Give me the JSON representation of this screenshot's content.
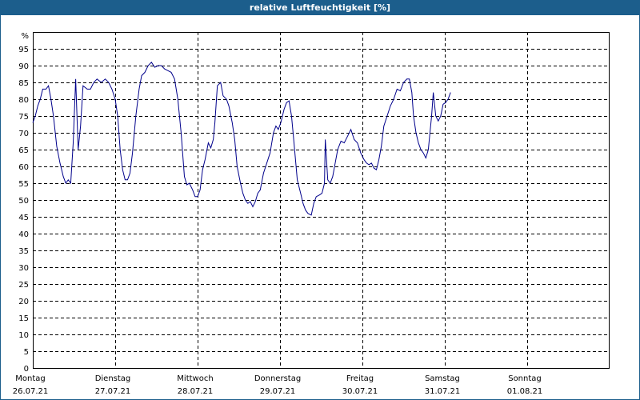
{
  "chart_data": {
    "type": "line",
    "title": "relative Luftfeuchtigkeit [%]",
    "yunit": "%",
    "ylim": [
      0,
      100
    ],
    "yticks": [
      0,
      5,
      10,
      15,
      20,
      25,
      30,
      35,
      40,
      45,
      50,
      55,
      60,
      65,
      70,
      75,
      80,
      85,
      90,
      95
    ],
    "xlim": [
      0,
      7
    ],
    "grid": true,
    "days": [
      {
        "name": "Montag",
        "date": "26.07.21"
      },
      {
        "name": "Dienstag",
        "date": "27.07.21"
      },
      {
        "name": "Mittwoch",
        "date": "28.07.21"
      },
      {
        "name": "Donnerstag",
        "date": "29.07.21"
      },
      {
        "name": "Freitag",
        "date": "30.07.21"
      },
      {
        "name": "Samstag",
        "date": "31.07.21"
      },
      {
        "name": "Sonntag",
        "date": "01.08.21"
      }
    ],
    "series": [
      {
        "color": "#00008b",
        "points": [
          [
            0.0,
            73
          ],
          [
            0.03,
            75
          ],
          [
            0.06,
            78
          ],
          [
            0.09,
            80
          ],
          [
            0.12,
            83
          ],
          [
            0.16,
            83
          ],
          [
            0.19,
            84
          ],
          [
            0.22,
            80
          ],
          [
            0.25,
            75
          ],
          [
            0.29,
            66
          ],
          [
            0.33,
            61
          ],
          [
            0.37,
            57
          ],
          [
            0.4,
            55
          ],
          [
            0.43,
            56
          ],
          [
            0.46,
            55
          ],
          [
            0.49,
            67
          ],
          [
            0.52,
            86
          ],
          [
            0.55,
            65
          ],
          [
            0.58,
            72
          ],
          [
            0.61,
            84
          ],
          [
            0.66,
            83
          ],
          [
            0.7,
            83
          ],
          [
            0.74,
            85
          ],
          [
            0.78,
            86
          ],
          [
            0.83,
            85
          ],
          [
            0.88,
            86
          ],
          [
            0.92,
            85
          ],
          [
            0.96,
            83
          ],
          [
            1.0,
            80
          ],
          [
            1.03,
            75
          ],
          [
            1.06,
            65
          ],
          [
            1.09,
            59
          ],
          [
            1.12,
            56
          ],
          [
            1.15,
            56
          ],
          [
            1.18,
            58
          ],
          [
            1.21,
            64
          ],
          [
            1.25,
            75
          ],
          [
            1.29,
            83
          ],
          [
            1.32,
            87
          ],
          [
            1.36,
            88
          ],
          [
            1.4,
            90
          ],
          [
            1.44,
            91
          ],
          [
            1.48,
            89.5
          ],
          [
            1.52,
            90
          ],
          [
            1.56,
            90
          ],
          [
            1.6,
            89
          ],
          [
            1.64,
            88.5
          ],
          [
            1.68,
            88
          ],
          [
            1.72,
            86
          ],
          [
            1.76,
            80
          ],
          [
            1.8,
            70
          ],
          [
            1.84,
            57
          ],
          [
            1.87,
            54.5
          ],
          [
            1.9,
            55
          ],
          [
            1.94,
            53
          ],
          [
            1.97,
            51
          ],
          [
            2.0,
            51
          ],
          [
            2.03,
            53
          ],
          [
            2.06,
            59
          ],
          [
            2.09,
            62
          ],
          [
            2.13,
            67
          ],
          [
            2.16,
            65.5
          ],
          [
            2.19,
            68
          ],
          [
            2.21,
            73
          ],
          [
            2.24,
            84
          ],
          [
            2.28,
            85
          ],
          [
            2.31,
            81
          ],
          [
            2.35,
            80
          ],
          [
            2.38,
            78
          ],
          [
            2.42,
            73
          ],
          [
            2.45,
            68
          ],
          [
            2.48,
            60
          ],
          [
            2.52,
            55
          ],
          [
            2.55,
            52
          ],
          [
            2.58,
            50
          ],
          [
            2.61,
            49
          ],
          [
            2.64,
            49.5
          ],
          [
            2.67,
            48
          ],
          [
            2.7,
            49.5
          ],
          [
            2.73,
            52
          ],
          [
            2.76,
            53
          ],
          [
            2.8,
            58
          ],
          [
            2.84,
            61
          ],
          [
            2.88,
            64
          ],
          [
            2.92,
            70
          ],
          [
            2.95,
            72
          ],
          [
            2.98,
            71
          ],
          [
            3.01,
            73
          ],
          [
            3.05,
            77
          ],
          [
            3.08,
            79
          ],
          [
            3.11,
            79.5
          ],
          [
            3.14,
            75
          ],
          [
            3.17,
            67
          ],
          [
            3.21,
            56
          ],
          [
            3.25,
            52
          ],
          [
            3.28,
            49
          ],
          [
            3.31,
            47
          ],
          [
            3.34,
            46
          ],
          [
            3.38,
            45.5
          ],
          [
            3.41,
            49
          ],
          [
            3.44,
            51
          ],
          [
            3.48,
            51.5
          ],
          [
            3.51,
            52
          ],
          [
            3.54,
            55
          ],
          [
            3.55,
            68
          ],
          [
            3.58,
            56
          ],
          [
            3.61,
            55
          ],
          [
            3.64,
            57
          ],
          [
            3.67,
            61
          ],
          [
            3.7,
            65
          ],
          [
            3.74,
            67.5
          ],
          [
            3.78,
            67
          ],
          [
            3.82,
            69
          ],
          [
            3.86,
            71
          ],
          [
            3.9,
            68
          ],
          [
            3.94,
            67
          ],
          [
            3.98,
            64
          ],
          [
            4.02,
            62
          ],
          [
            4.05,
            61
          ],
          [
            4.08,
            60.5
          ],
          [
            4.11,
            61
          ],
          [
            4.14,
            59.5
          ],
          [
            4.17,
            59
          ],
          [
            4.2,
            62
          ],
          [
            4.23,
            66
          ],
          [
            4.26,
            72
          ],
          [
            4.3,
            75
          ],
          [
            4.34,
            78
          ],
          [
            4.38,
            80
          ],
          [
            4.42,
            83
          ],
          [
            4.46,
            82.5
          ],
          [
            4.5,
            85
          ],
          [
            4.54,
            86
          ],
          [
            4.57,
            86
          ],
          [
            4.6,
            82
          ],
          [
            4.62,
            75
          ],
          [
            4.65,
            70
          ],
          [
            4.68,
            67
          ],
          [
            4.71,
            65
          ],
          [
            4.74,
            64
          ],
          [
            4.77,
            62.5
          ],
          [
            4.8,
            65
          ],
          [
            4.84,
            75
          ],
          [
            4.86,
            82
          ],
          [
            4.89,
            75
          ],
          [
            4.92,
            73.5
          ],
          [
            4.95,
            75
          ],
          [
            4.98,
            78.5
          ],
          [
            5.01,
            79
          ],
          [
            5.04,
            80
          ],
          [
            5.07,
            82
          ]
        ]
      }
    ]
  }
}
